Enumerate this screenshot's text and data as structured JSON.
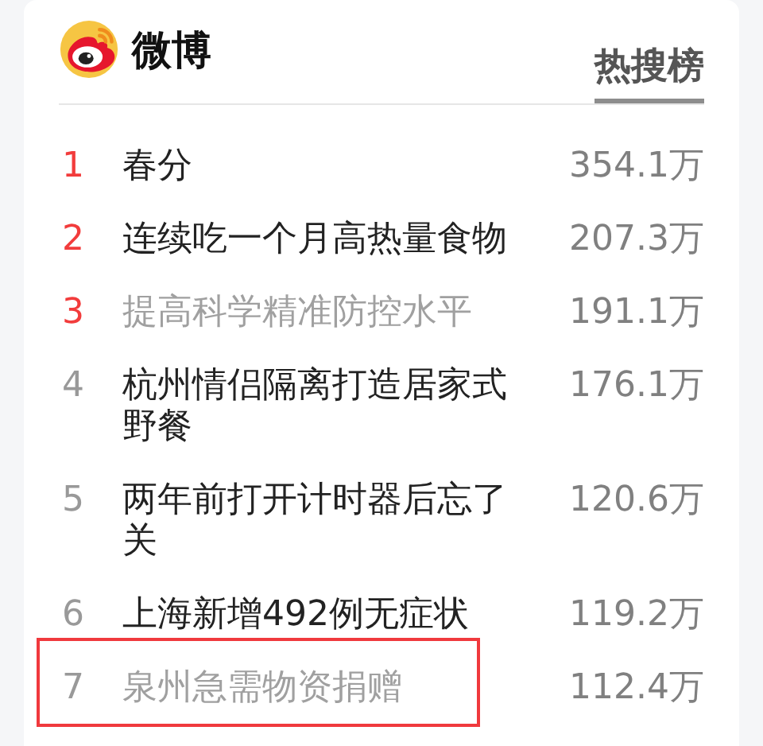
{
  "header": {
    "brand": "微博",
    "tab": {
      "label": "热搜榜",
      "selected": true
    }
  },
  "rows": [
    {
      "rank": "1",
      "title": "春分",
      "count": "354.1万",
      "top": true,
      "visited": false,
      "highlighted": false
    },
    {
      "rank": "2",
      "title": "连续吃一个月高热量食物",
      "count": "207.3万",
      "top": true,
      "visited": false,
      "highlighted": false
    },
    {
      "rank": "3",
      "title": "提高科学精准防控水平",
      "count": "191.1万",
      "top": true,
      "visited": true,
      "highlighted": false
    },
    {
      "rank": "4",
      "title": "杭州情侣隔离打造居家式野餐",
      "count": "176.1万",
      "top": false,
      "visited": false,
      "highlighted": false
    },
    {
      "rank": "5",
      "title": "两年前打开计时器后忘了关",
      "count": "120.6万",
      "top": false,
      "visited": false,
      "highlighted": false
    },
    {
      "rank": "6",
      "title": "上海新增492例无症状",
      "count": "119.2万",
      "top": false,
      "visited": false,
      "highlighted": false
    },
    {
      "rank": "7",
      "title": "泉州急需物资捐赠",
      "count": "112.4万",
      "top": false,
      "visited": true,
      "highlighted": true
    }
  ]
}
